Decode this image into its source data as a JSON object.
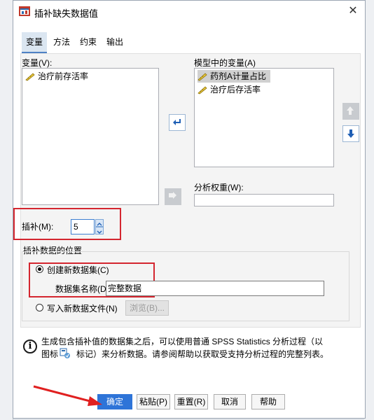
{
  "dialog": {
    "title": "插补缺失数据值",
    "close": "✕"
  },
  "tabs": [
    "变量",
    "方法",
    "约束",
    "输出"
  ],
  "variables": {
    "label": "变量(V):",
    "items": [
      "治疗前存活率"
    ]
  },
  "model": {
    "label": "模型中的变量(A)",
    "items": [
      "药剂A计量占比",
      "治疗后存活率"
    ]
  },
  "weight": {
    "label": "分析权重(W):"
  },
  "impute": {
    "label": "插补(M):",
    "value": "5"
  },
  "location": {
    "group_label": "插补数据的位置",
    "create_label": "创建新数据集(C)",
    "dataset_name_label": "数据集名称(D",
    "dataset_name_value": "完整数据",
    "write_label": "写入新数据文件(N)",
    "browse_label": "浏览(B)..."
  },
  "info": {
    "line1": "生成包含插补值的数据集之后，可以使用普通 SPSS Statistics 分析过程（以",
    "line2_a": "图标",
    "line2_b": "标记）来分析数据。请参阅帮助以获取受支持分析过程的完整列表。"
  },
  "buttons": {
    "ok": "确定",
    "paste": "粘贴(P)",
    "reset": "重置(R)",
    "cancel": "取消",
    "help": "帮助"
  },
  "colors": {
    "primary": "#2e74d8",
    "highlight": "#d4262f"
  }
}
